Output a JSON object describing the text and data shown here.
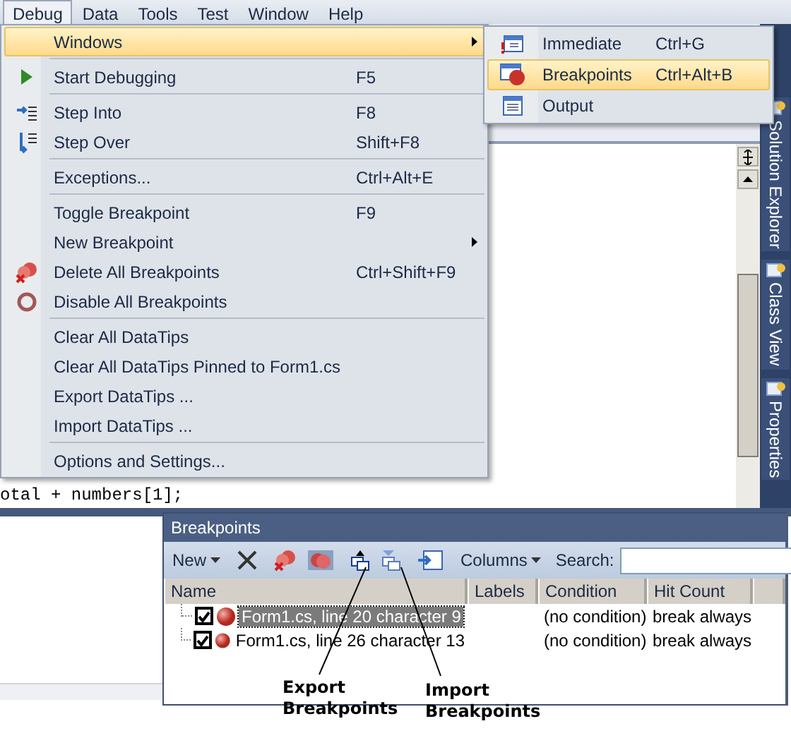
{
  "menubar": [
    {
      "label": "Debug",
      "selected": true
    },
    {
      "label": "Data",
      "selected": false
    },
    {
      "label": "Tools",
      "selected": false
    },
    {
      "label": "Test",
      "selected": false
    },
    {
      "label": "Window",
      "selected": false
    },
    {
      "label": "Help",
      "selected": false
    }
  ],
  "debug_menu": [
    {
      "kind": "item",
      "label": "Windows",
      "submenu": true,
      "selected": true
    },
    {
      "kind": "separator"
    },
    {
      "kind": "item",
      "label": "Start Debugging",
      "shortcut": "F5",
      "selected": false
    },
    {
      "kind": "separator"
    },
    {
      "kind": "item",
      "label": "Step Into",
      "shortcut": "F8",
      "selected": false
    },
    {
      "kind": "item",
      "label": "Step Over",
      "shortcut": "Shift+F8",
      "selected": false
    },
    {
      "kind": "separator"
    },
    {
      "kind": "item",
      "label": "Exceptions...",
      "shortcut": "Ctrl+Alt+E",
      "selected": false
    },
    {
      "kind": "separator"
    },
    {
      "kind": "item",
      "label": "Toggle Breakpoint",
      "shortcut": "F9",
      "selected": false
    },
    {
      "kind": "item",
      "label": "New Breakpoint",
      "submenu": true,
      "selected": false
    },
    {
      "kind": "item",
      "label": "Delete All Breakpoints",
      "shortcut": "Ctrl+Shift+F9",
      "selected": false
    },
    {
      "kind": "item",
      "label": "Disable All Breakpoints",
      "selected": false
    },
    {
      "kind": "separator"
    },
    {
      "kind": "item",
      "label": "Clear All DataTips",
      "selected": false
    },
    {
      "kind": "item",
      "label": "Clear All DataTips Pinned to Form1.cs",
      "selected": false
    },
    {
      "kind": "item",
      "label": "Export DataTips ...",
      "selected": false
    },
    {
      "kind": "item",
      "label": "Import DataTips ...",
      "selected": false
    },
    {
      "kind": "separator"
    },
    {
      "kind": "item",
      "label": "Options and Settings...",
      "selected": false
    }
  ],
  "windows_submenu": [
    {
      "label": "Immediate",
      "shortcut": "Ctrl+G",
      "selected": false
    },
    {
      "label": "Breakpoints",
      "shortcut": "Ctrl+Alt+B",
      "selected": true
    },
    {
      "label": "Output",
      "selected": false
    }
  ],
  "editor": {
    "code_lines": [
      "otal + numbers[1];"
    ]
  },
  "side_tabs": [
    "Solution Explorer",
    "Class View",
    "Properties"
  ],
  "breakpoints_window": {
    "title": "Breakpoints",
    "toolbar": {
      "new_label": "New",
      "columns_label": "Columns",
      "search_label": "Search:"
    },
    "columns": [
      "Name",
      "Labels",
      "Condition",
      "Hit Count"
    ],
    "rows": [
      {
        "checked": true,
        "selected": true,
        "name": "Form1.cs, line 20 character 9",
        "condition": "(no condition)",
        "hit_count": "break always"
      },
      {
        "checked": true,
        "selected": false,
        "name": "Form1.cs, line 26 character 13",
        "condition": "(no condition)",
        "hit_count": "break always"
      }
    ]
  },
  "annotations": [
    "Export Breakpoints",
    "Import Breakpoints"
  ]
}
